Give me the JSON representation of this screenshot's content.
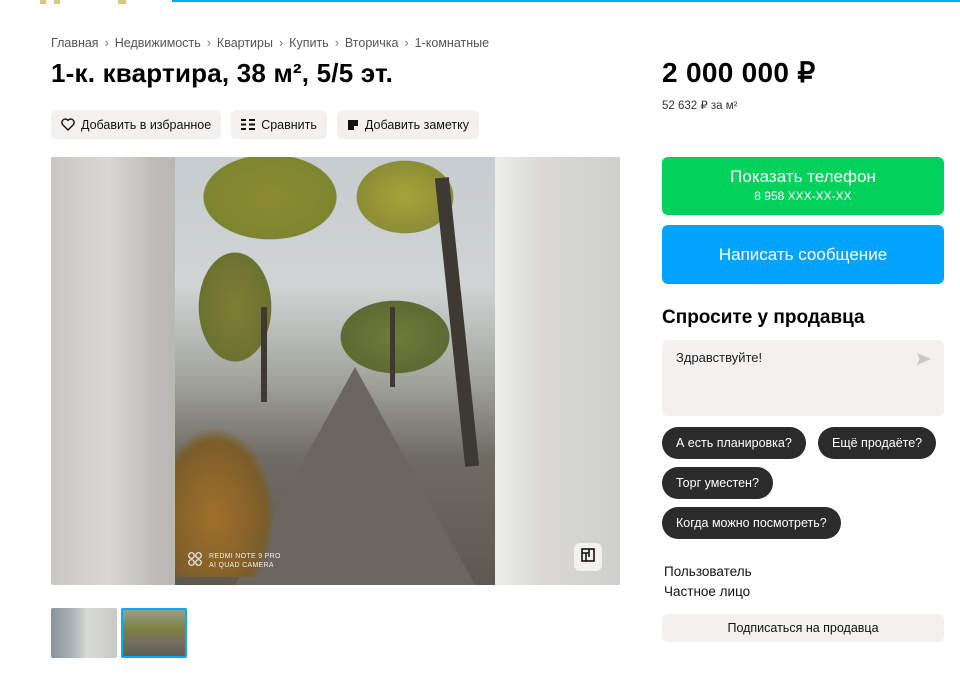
{
  "breadcrumb": [
    "Главная",
    "Недвижимость",
    "Квартиры",
    "Купить",
    "Вторичка",
    "1-комнатные"
  ],
  "breadcrumb_separator": "›",
  "title": "1-к. квартира, 38 м², 5/5 эт.",
  "actions": {
    "favorite": "Добавить в избранное",
    "compare": "Сравнить",
    "note": "Добавить заметку"
  },
  "gallery": {
    "camera_line1": "REDMI NOTE 9 PRO",
    "camera_line2": "AI QUAD CAMERA",
    "thumbnails_count": 2,
    "selected_thumbnail": 2
  },
  "price": {
    "total": "2 000 000 ₽",
    "per_sqm": "52 632 ₽ за м²"
  },
  "contact": {
    "phone_label": "Показать телефон",
    "phone_masked": "8 958 XXX-XX-XX",
    "message_label": "Написать сообщение"
  },
  "ask": {
    "title": "Спросите у продавца",
    "input_value": "Здравствуйте!",
    "chips": [
      "А есть планировка?",
      "Ещё продаёте?",
      "Торг уместен?",
      "Когда можно посмотреть?"
    ]
  },
  "seller": {
    "name": "Пользователь",
    "type": "Частное лицо",
    "subscribe": "Подписаться на продавца"
  },
  "colors": {
    "phone_button": "#02d15c",
    "message_button": "#00a4ff",
    "chip": "#2c2b2b",
    "light_button": "#f2f1f0"
  },
  "icons": [
    "heart-icon",
    "compare-icon",
    "note-icon",
    "send-icon",
    "floor-plan-icon",
    "camera-logo-icon"
  ]
}
